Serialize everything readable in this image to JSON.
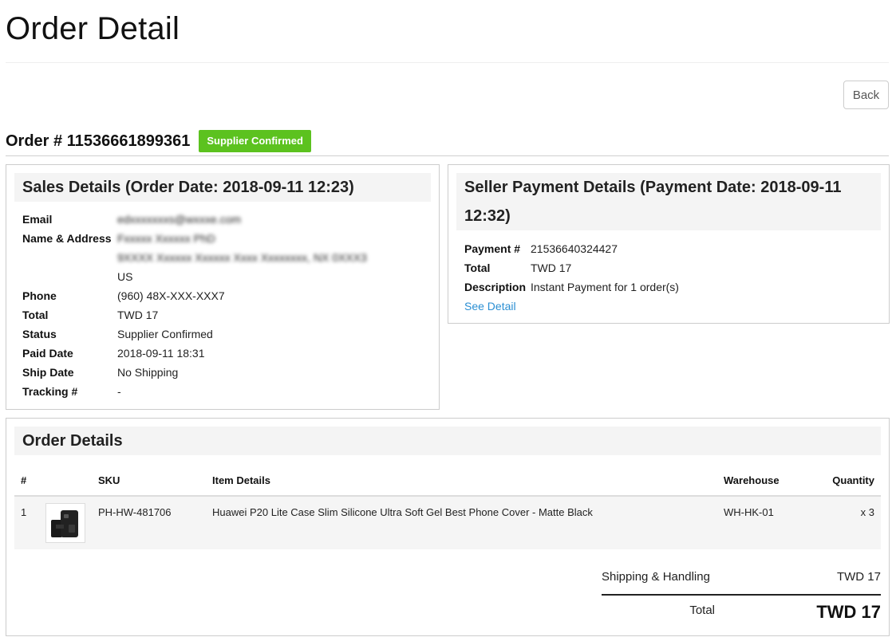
{
  "page": {
    "title": "Order Detail",
    "back_label": "Back"
  },
  "order": {
    "number_label": "Order # 11536661899361",
    "status_badge": "Supplier Confirmed",
    "status_color": "#5cc21f"
  },
  "sales": {
    "heading": "Sales Details (Order Date: 2018-09-11 12:23)",
    "email_label": "Email",
    "email_value": "edxxxxxxxs@wxxxe.com",
    "name_label": "Name & Address",
    "name_value": "Fxxxxx Xxxxxx PhD",
    "address_line": "9XXXX Xxxxxx Xxxxxx Xxxx Xxxxxxxx, NX 0XXX3",
    "country": "US",
    "phone_label": "Phone",
    "phone_value": "(960) 48X-XXX-XXX7",
    "total_label": "Total",
    "total_value": "TWD 17",
    "status_label": "Status",
    "status_value": "Supplier Confirmed",
    "paid_label": "Paid Date",
    "paid_value": "2018-09-11 18:31",
    "ship_label": "Ship Date",
    "ship_value": "No Shipping",
    "tracking_label": "Tracking #",
    "tracking_value": "-"
  },
  "payment": {
    "heading_line1": "Seller Payment Details (Payment Date: 2018-09-11",
    "heading_line2": "12:32)",
    "payment_label": "Payment #",
    "payment_value": "21536640324427",
    "total_label": "Total",
    "total_value": "TWD 17",
    "desc_label": "Description",
    "desc_value": "Instant Payment for 1 order(s)",
    "see_detail": "See Detail",
    "link_color": "#2b8fd3"
  },
  "order_details": {
    "heading": "Order Details",
    "columns": {
      "num": "#",
      "sku": "SKU",
      "item": "Item Details",
      "warehouse": "Warehouse",
      "qty": "Quantity"
    },
    "rows": [
      {
        "num": "1",
        "sku": "PH-HW-481706",
        "item": "Huawei P20 Lite Case Slim Silicone Ultra Soft Gel Best Phone Cover - Matte Black",
        "warehouse": "WH-HK-01",
        "qty": "x 3"
      }
    ],
    "shipping_label": "Shipping & Handling",
    "shipping_value": "TWD 17",
    "total_label": "Total",
    "total_value": "TWD 17"
  }
}
